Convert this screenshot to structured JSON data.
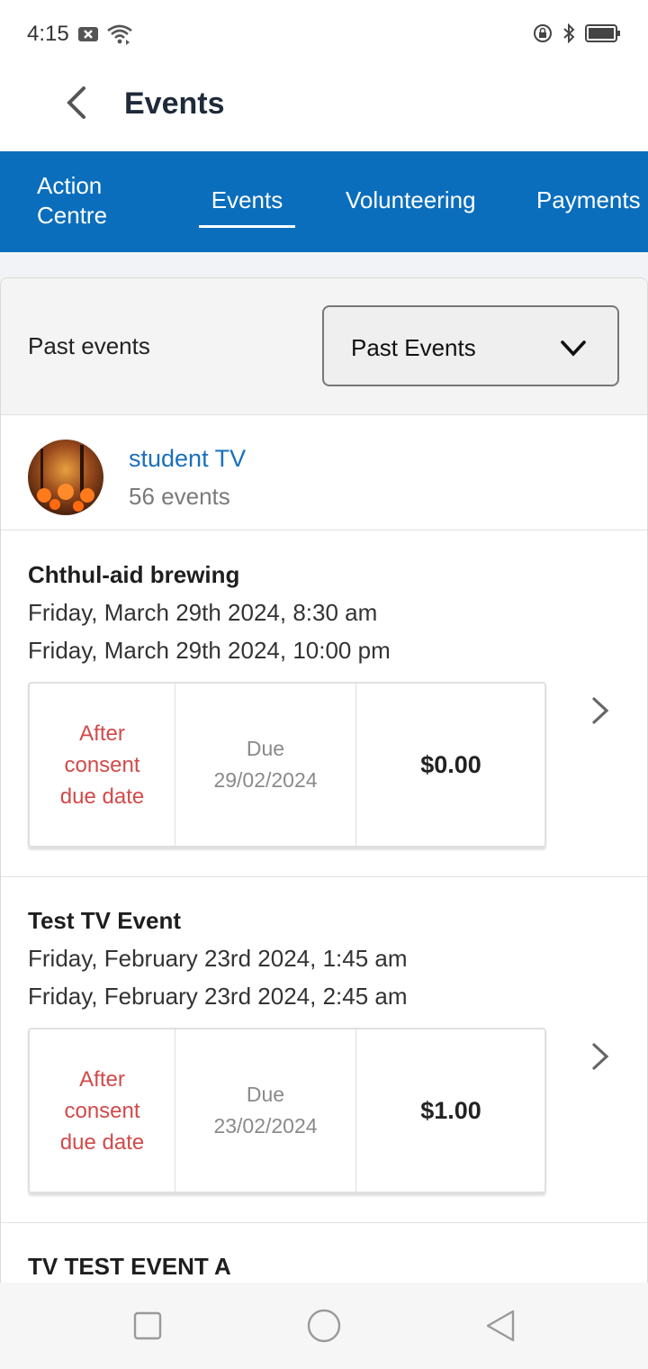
{
  "status_bar": {
    "time": "4:15",
    "icons_left": [
      "notification-x-icon",
      "wifi-icon"
    ],
    "icons_right": [
      "lock-rotation-icon",
      "bluetooth-icon",
      "battery-icon"
    ]
  },
  "app_bar": {
    "title": "Events",
    "back_icon": "chevron-left-icon"
  },
  "tabs": [
    {
      "label": "Action\nCentre",
      "active": false
    },
    {
      "label": "Events",
      "active": true
    },
    {
      "label": "Volunteering",
      "active": false
    },
    {
      "label": "Payments",
      "active": false
    }
  ],
  "filter": {
    "label": "Past events",
    "selected": "Past Events"
  },
  "group": {
    "name": "student TV",
    "count": "56 events"
  },
  "events": [
    {
      "title": "Chthul-aid brewing",
      "start": "Friday, March 29th 2024, 8:30 am",
      "end": "Friday, March 29th 2024, 10:00 pm",
      "status": "After consent due date",
      "due_label": "Due",
      "due_date": "29/02/2024",
      "amount": "$0.00"
    },
    {
      "title": "Test TV Event",
      "start": "Friday, February 23rd 2024, 1:45 am",
      "end": "Friday, February 23rd 2024, 2:45 am",
      "status": "After consent due date",
      "due_label": "Due",
      "due_date": "23/02/2024",
      "amount": "$1.00"
    },
    {
      "title": "TV TEST EVENT A"
    }
  ],
  "colors": {
    "tab_bar": "#0a6ebd",
    "link": "#1a6fbd",
    "status_red": "#d24a4a"
  },
  "nav_bar": [
    "recents-square-icon",
    "home-circle-icon",
    "back-triangle-icon"
  ]
}
